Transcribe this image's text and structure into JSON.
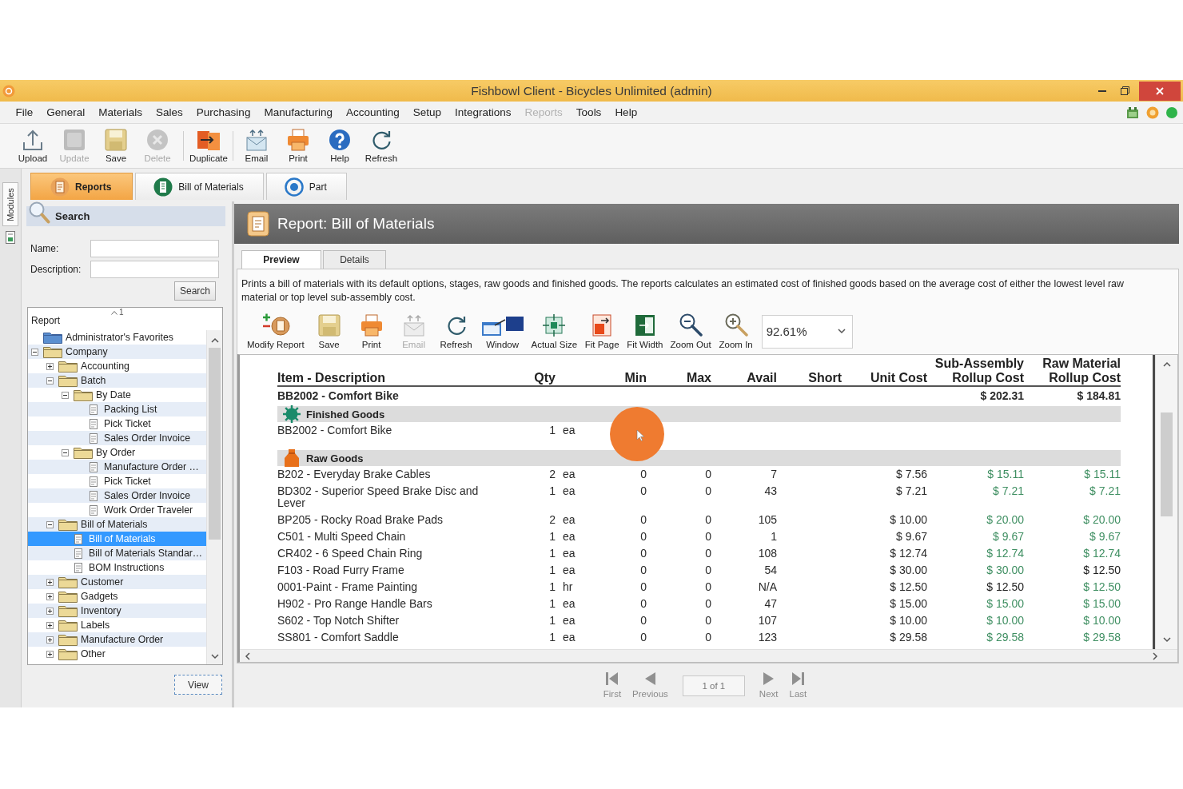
{
  "window": {
    "title": "Fishbowl Client - Bicycles Unlimited (admin)"
  },
  "menu": [
    {
      "label": "File",
      "disabled": false
    },
    {
      "label": "General",
      "disabled": false
    },
    {
      "label": "Materials",
      "disabled": false
    },
    {
      "label": "Sales",
      "disabled": false
    },
    {
      "label": "Purchasing",
      "disabled": false
    },
    {
      "label": "Manufacturing",
      "disabled": false
    },
    {
      "label": "Accounting",
      "disabled": false
    },
    {
      "label": "Setup",
      "disabled": false
    },
    {
      "label": "Integrations",
      "disabled": false
    },
    {
      "label": "Reports",
      "disabled": true
    },
    {
      "label": "Tools",
      "disabled": false
    },
    {
      "label": "Help",
      "disabled": false
    }
  ],
  "toolbar_groups": [
    {
      "buttons": [
        {
          "label": "Upload",
          "disabled": false
        },
        {
          "label": "Update",
          "disabled": true
        },
        {
          "label": "Save",
          "disabled": false
        },
        {
          "label": "Delete",
          "disabled": true
        }
      ]
    },
    {
      "buttons": [
        {
          "label": "Duplicate",
          "disabled": false
        }
      ]
    },
    {
      "buttons": [
        {
          "label": "Email",
          "disabled": false
        },
        {
          "label": "Print",
          "disabled": false
        },
        {
          "label": "Help",
          "disabled": false
        },
        {
          "label": "Refresh",
          "disabled": false
        }
      ]
    }
  ],
  "modules_tab": {
    "label": "Modules"
  },
  "module_tabs": [
    {
      "label": "Reports",
      "selected": true
    },
    {
      "label": "Bill of Materials",
      "selected": false
    },
    {
      "label": "Part",
      "selected": false
    }
  ],
  "search_panel": {
    "title": "Search",
    "fields": [
      {
        "label": "Name:"
      },
      {
        "label": "Description:"
      }
    ],
    "button": "Search"
  },
  "report_tree": {
    "column": "Report",
    "sort_order": "1",
    "items": [
      {
        "label": "Administrator's Favorites",
        "kind": "favorites",
        "selected": false
      },
      {
        "label": "Company",
        "kind": "folder",
        "expanded": true,
        "selected": false,
        "children": [
          {
            "label": "Accounting",
            "kind": "folder",
            "expanded": false,
            "selected": false
          },
          {
            "label": "Batch",
            "kind": "folder",
            "expanded": true,
            "selected": false,
            "children": [
              {
                "label": "By Date",
                "kind": "folder",
                "expanded": true,
                "selected": false,
                "children": [
                  {
                    "label": "Packing List",
                    "kind": "report",
                    "selected": false
                  },
                  {
                    "label": "Pick Ticket",
                    "kind": "report",
                    "selected": false
                  },
                  {
                    "label": "Sales Order Invoice",
                    "kind": "report",
                    "selected": false
                  }
                ]
              },
              {
                "label": "By Order",
                "kind": "folder",
                "expanded": true,
                "selected": false,
                "children": [
                  {
                    "label": "Manufacture Order …",
                    "kind": "report",
                    "selected": false
                  },
                  {
                    "label": "Pick Ticket",
                    "kind": "report",
                    "selected": false
                  },
                  {
                    "label": "Sales Order Invoice",
                    "kind": "report",
                    "selected": false
                  },
                  {
                    "label": "Work Order Traveler",
                    "kind": "report",
                    "selected": false
                  }
                ]
              }
            ]
          },
          {
            "label": "Bill of Materials",
            "kind": "folder",
            "expanded": true,
            "selected": false,
            "children": [
              {
                "label": "Bill of Materials",
                "kind": "report",
                "selected": true
              },
              {
                "label": "Bill of Materials Standar…",
                "kind": "report",
                "selected": false
              },
              {
                "label": "BOM Instructions",
                "kind": "report",
                "selected": false
              }
            ]
          },
          {
            "label": "Customer",
            "kind": "folder",
            "expanded": false,
            "selected": false
          },
          {
            "label": "Gadgets",
            "kind": "folder",
            "expanded": false,
            "selected": false
          },
          {
            "label": "Inventory",
            "kind": "folder",
            "expanded": false,
            "selected": false
          },
          {
            "label": "Labels",
            "kind": "folder",
            "expanded": false,
            "selected": false
          },
          {
            "label": "Manufacture Order",
            "kind": "folder",
            "expanded": false,
            "selected": false
          },
          {
            "label": "Other",
            "kind": "folder",
            "expanded": false,
            "selected": false
          }
        ]
      }
    ]
  },
  "view_button": "View",
  "report": {
    "title": "Report: Bill of Materials",
    "tabs": [
      {
        "label": "Preview",
        "selected": true
      },
      {
        "label": "Details",
        "selected": false
      }
    ],
    "description": "Prints a bill of materials with its default options, stages, raw goods and finished goods. The reports calculates an estimated cost of finished goods based on the average cost of either the lowest level raw material or top level sub-assembly cost.",
    "toolbar": [
      {
        "label": "Modify Report",
        "disabled": false
      },
      {
        "label": "Save",
        "disabled": false
      },
      {
        "label": "Print",
        "disabled": false
      },
      {
        "label": "Email",
        "disabled": true
      },
      {
        "label": "Refresh",
        "disabled": false
      },
      {
        "label": "Window",
        "disabled": false
      },
      {
        "label": "Actual Size",
        "disabled": false
      },
      {
        "label": "Fit Page",
        "disabled": false
      },
      {
        "label": "Fit Width",
        "disabled": false
      },
      {
        "label": "Zoom Out",
        "disabled": false
      },
      {
        "label": "Zoom In",
        "disabled": false
      }
    ],
    "zoom": "92.61%",
    "table": {
      "columns": [
        "Item - Description",
        "Qty",
        "Min",
        "Max",
        "Avail",
        "Short",
        "Unit Cost",
        "Sub-Assembly Rollup Cost",
        "Raw Material Rollup Cost"
      ],
      "assembly": {
        "item": "BB2002 - Comfort Bike",
        "sub_assembly_rollup_cost": "$ 202.31",
        "raw_material_rollup_cost": "$ 184.81"
      },
      "sections": [
        {
          "title": "Finished Goods",
          "rows": [
            {
              "item": "BB2002 - Comfort Bike",
              "qty": "1",
              "uom": "ea"
            }
          ]
        },
        {
          "title": "Raw Goods",
          "rows": [
            {
              "item": "B202 - Everyday Brake Cables",
              "qty": "2",
              "uom": "ea",
              "min": "0",
              "max": "0",
              "avail": "7",
              "unit_cost": "$ 7.56",
              "sub_assembly_rollup_cost": {
                "text": "$ 15.11",
                "color": "#3f8f62"
              },
              "raw_material_rollup_cost": {
                "text": "$ 15.11",
                "color": "#3f8f62"
              }
            },
            {
              "item": "BD302 - Superior Speed Brake Disc and Lever",
              "qty": "1",
              "uom": "ea",
              "min": "0",
              "max": "0",
              "avail": "43",
              "unit_cost": "$ 7.21",
              "sub_assembly_rollup_cost": {
                "text": "$ 7.21",
                "color": "#3f8f62"
              },
              "raw_material_rollup_cost": {
                "text": "$ 7.21",
                "color": "#3f8f62"
              }
            },
            {
              "item": "BP205 - Rocky Road Brake Pads",
              "qty": "2",
              "uom": "ea",
              "min": "0",
              "max": "0",
              "avail": "105",
              "unit_cost": "$ 10.00",
              "sub_assembly_rollup_cost": {
                "text": "$ 20.00",
                "color": "#3f8f62"
              },
              "raw_material_rollup_cost": {
                "text": "$ 20.00",
                "color": "#3f8f62"
              }
            },
            {
              "item": "C501 - Multi Speed Chain",
              "qty": "1",
              "uom": "ea",
              "min": "0",
              "max": "0",
              "avail": "1",
              "unit_cost": "$ 9.67",
              "sub_assembly_rollup_cost": {
                "text": "$ 9.67",
                "color": "#3f8f62"
              },
              "raw_material_rollup_cost": {
                "text": "$ 9.67",
                "color": "#3f8f62"
              }
            },
            {
              "item": "CR402 - 6 Speed Chain Ring",
              "qty": "1",
              "uom": "ea",
              "min": "0",
              "max": "0",
              "avail": "108",
              "unit_cost": "$ 12.74",
              "sub_assembly_rollup_cost": {
                "text": "$ 12.74",
                "color": "#3f8f62"
              },
              "raw_material_rollup_cost": {
                "text": "$ 12.74",
                "color": "#3f8f62"
              }
            },
            {
              "item": "F103 - Road Furry Frame",
              "qty": "1",
              "uom": "ea",
              "min": "0",
              "max": "0",
              "avail": "54",
              "unit_cost": "$ 30.00",
              "sub_assembly_rollup_cost": {
                "text": "$ 30.00",
                "color": "#3f8f62"
              },
              "raw_material_rollup_cost": {
                "text": "$ 12.50",
                "color": "#222222"
              }
            },
            {
              "item": "0001-Paint - Frame Painting",
              "qty": "1",
              "uom": "hr",
              "min": "0",
              "max": "0",
              "avail": "N/A",
              "unit_cost": "$ 12.50",
              "sub_assembly_rollup_cost": {
                "text": "$ 12.50",
                "color": "#222222"
              },
              "raw_material_rollup_cost": {
                "text": "$ 12.50",
                "color": "#3f8f62"
              }
            },
            {
              "item": "H902 - Pro Range Handle Bars",
              "qty": "1",
              "uom": "ea",
              "min": "0",
              "max": "0",
              "avail": "47",
              "unit_cost": "$ 15.00",
              "sub_assembly_rollup_cost": {
                "text": "$ 15.00",
                "color": "#3f8f62"
              },
              "raw_material_rollup_cost": {
                "text": "$ 15.00",
                "color": "#3f8f62"
              }
            },
            {
              "item": "S602 - Top Notch Shifter",
              "qty": "1",
              "uom": "ea",
              "min": "0",
              "max": "0",
              "avail": "107",
              "unit_cost": "$ 10.00",
              "sub_assembly_rollup_cost": {
                "text": "$ 10.00",
                "color": "#3f8f62"
              },
              "raw_material_rollup_cost": {
                "text": "$ 10.00",
                "color": "#3f8f62"
              }
            },
            {
              "item": "SS801 - Comfort Saddle",
              "qty": "1",
              "uom": "ea",
              "min": "0",
              "max": "0",
              "avail": "123",
              "unit_cost": "$ 29.58",
              "sub_assembly_rollup_cost": {
                "text": "$ 29.58",
                "color": "#3f8f62"
              },
              "raw_material_rollup_cost": {
                "text": "$ 29.58",
                "color": "#3f8f62"
              }
            }
          ]
        }
      ]
    },
    "pager": {
      "first": {
        "label": "First",
        "disabled": true
      },
      "previous": {
        "label": "Previous",
        "disabled": true
      },
      "page": "1 of 1",
      "next": {
        "label": "Next",
        "disabled": true
      },
      "last": {
        "label": "Last",
        "disabled": true
      }
    }
  }
}
